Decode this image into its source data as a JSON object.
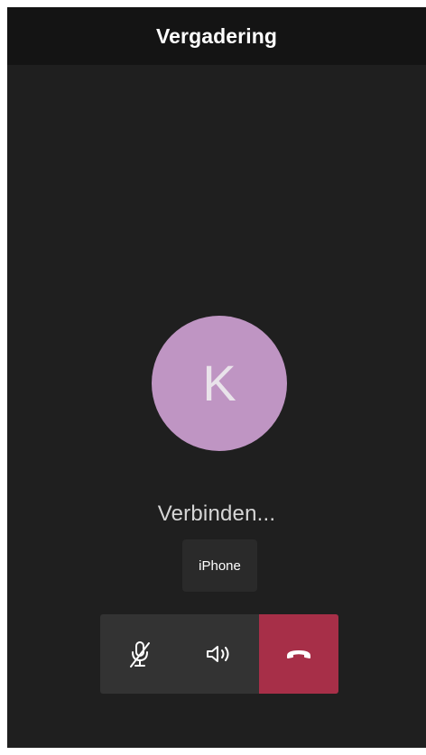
{
  "header": {
    "title": "Vergadering"
  },
  "call": {
    "avatar_initial": "K",
    "avatar_color": "#bf95c3",
    "status": "Verbinden...",
    "device_label": "iPhone"
  },
  "controls": {
    "mute_icon": "microphone-off-icon",
    "speaker_icon": "speaker-icon",
    "end_call_icon": "hang-up-icon",
    "end_call_color": "#a72f48"
  }
}
